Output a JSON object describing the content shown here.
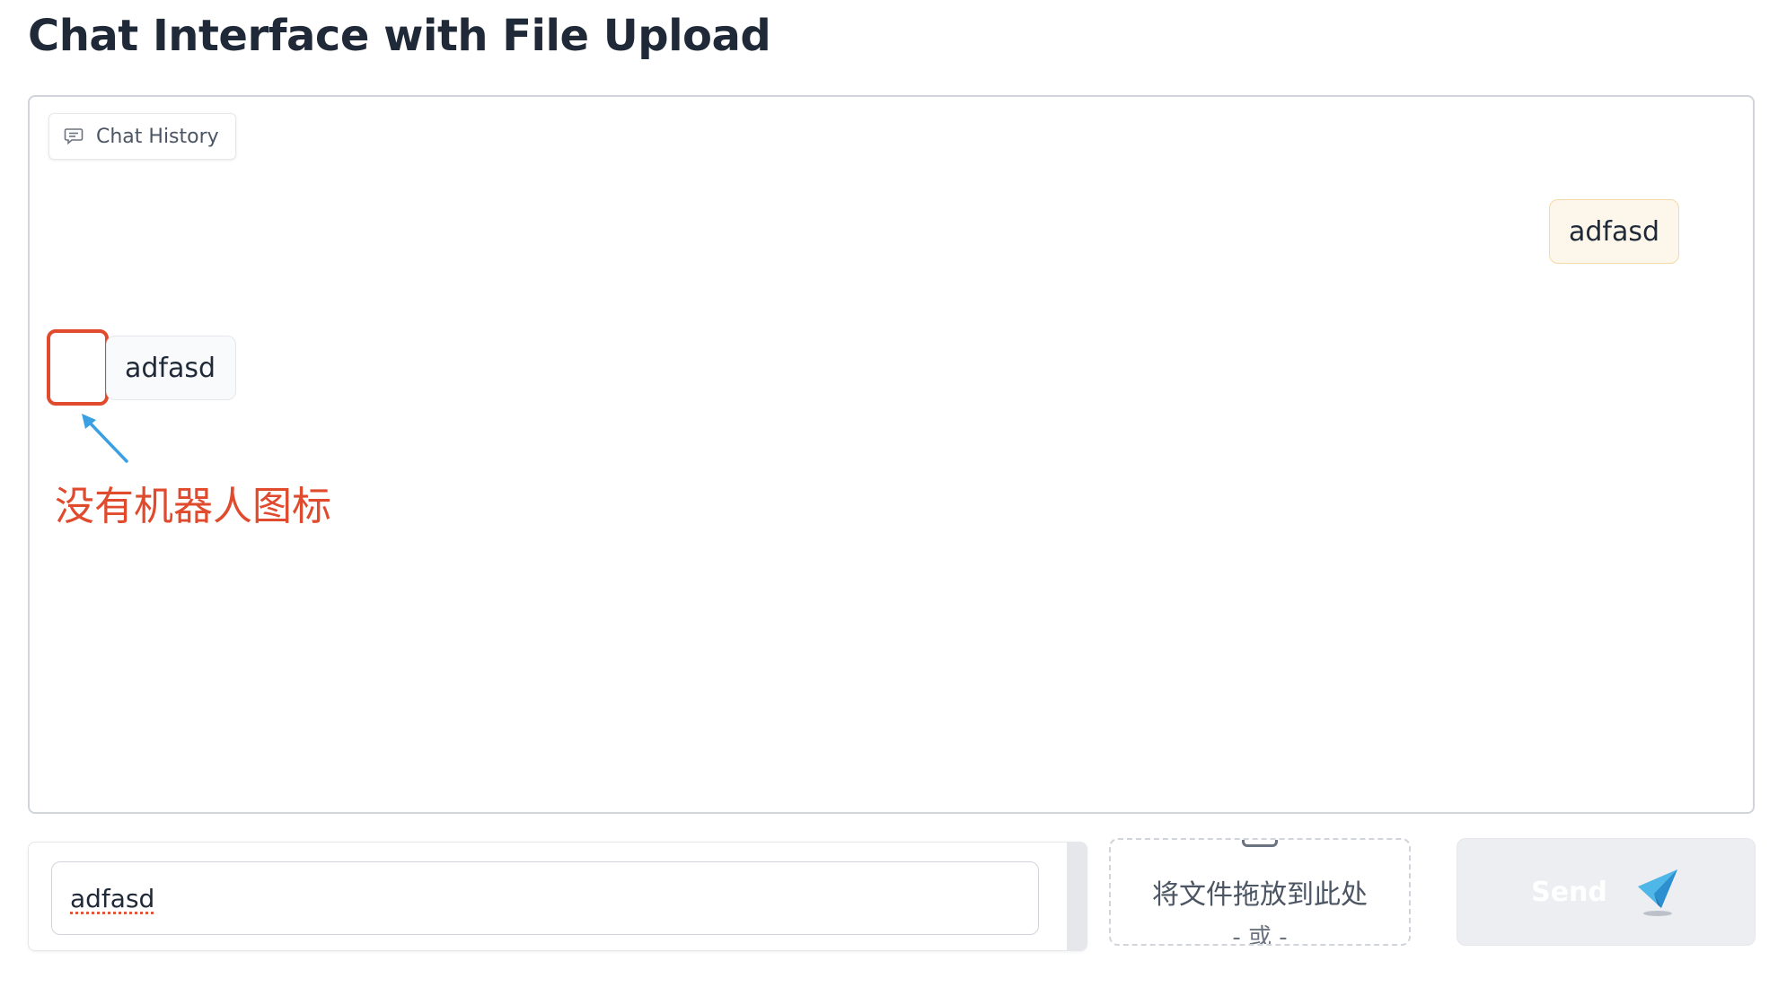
{
  "page": {
    "title": "Chat Interface with File Upload"
  },
  "chat": {
    "history_label": "Chat History",
    "messages": [
      {
        "role": "user",
        "text": "adfasd"
      },
      {
        "role": "bot",
        "text": "adfasd"
      }
    ]
  },
  "annotation": {
    "text": "没有机器人图标",
    "color": "#e04b2e",
    "arrow_color": "#3b9fe3"
  },
  "composer": {
    "input_value": "adfasd",
    "upload_drop_text": "将文件拖放到此处",
    "upload_or_text": "- 或 -",
    "send_label": "Send",
    "send_icon": "paper-plane-icon"
  },
  "colors": {
    "user_bubble_bg": "#fdf6ea",
    "user_bubble_border": "#f5d9a8",
    "bot_bubble_bg": "#f9fafb",
    "send_button_bg": "#eceef1"
  }
}
